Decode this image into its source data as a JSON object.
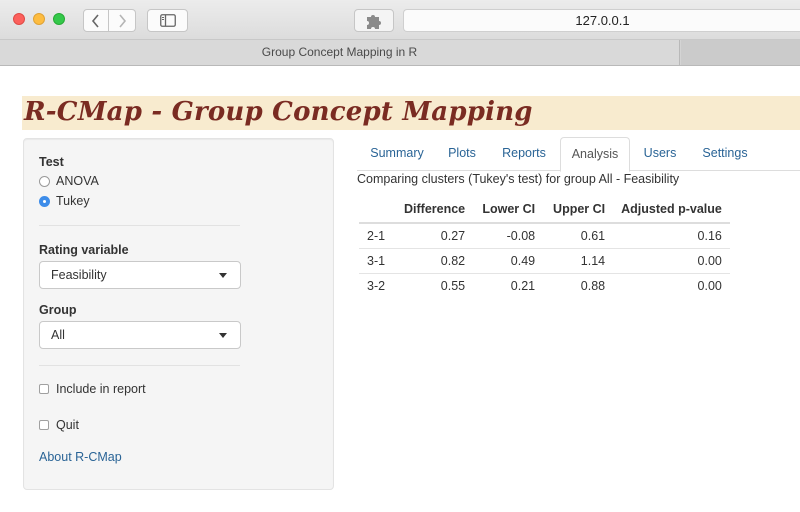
{
  "browser": {
    "url": "127.0.0.1",
    "tab_title": "Group Concept Mapping in R"
  },
  "app": {
    "title": "R-CMap - Group Concept Mapping",
    "colors": {
      "header_bg": "#f8ebcf",
      "title": "#7a2b22",
      "link": "#2a6496",
      "radio_selected": "#3d8ce9"
    }
  },
  "sidebar": {
    "test_label": "Test",
    "test_options": [
      {
        "label": "ANOVA",
        "selected": false
      },
      {
        "label": "Tukey",
        "selected": true
      }
    ],
    "rating_label": "Rating variable",
    "rating_value": "Feasibility",
    "group_label": "Group",
    "group_value": "All",
    "include_label": "Include in report",
    "quit_label": "Quit",
    "about_link": "About R-CMap"
  },
  "tabs": [
    {
      "label": "Summary",
      "active": false
    },
    {
      "label": "Plots",
      "active": false
    },
    {
      "label": "Reports",
      "active": false
    },
    {
      "label": "Analysis",
      "active": true
    },
    {
      "label": "Users",
      "active": false
    },
    {
      "label": "Settings",
      "active": false
    }
  ],
  "analysis": {
    "subtitle": "Comparing clusters (Tukey's test) for group All - Feasibility",
    "columns": [
      "",
      "Difference",
      "Lower CI",
      "Upper CI",
      "Adjusted p-value"
    ],
    "rows": [
      [
        "2-1",
        "0.27",
        "-0.08",
        "0.61",
        "0.16"
      ],
      [
        "3-1",
        "0.82",
        "0.49",
        "1.14",
        "0.00"
      ],
      [
        "3-2",
        "0.55",
        "0.21",
        "0.88",
        "0.00"
      ]
    ]
  }
}
